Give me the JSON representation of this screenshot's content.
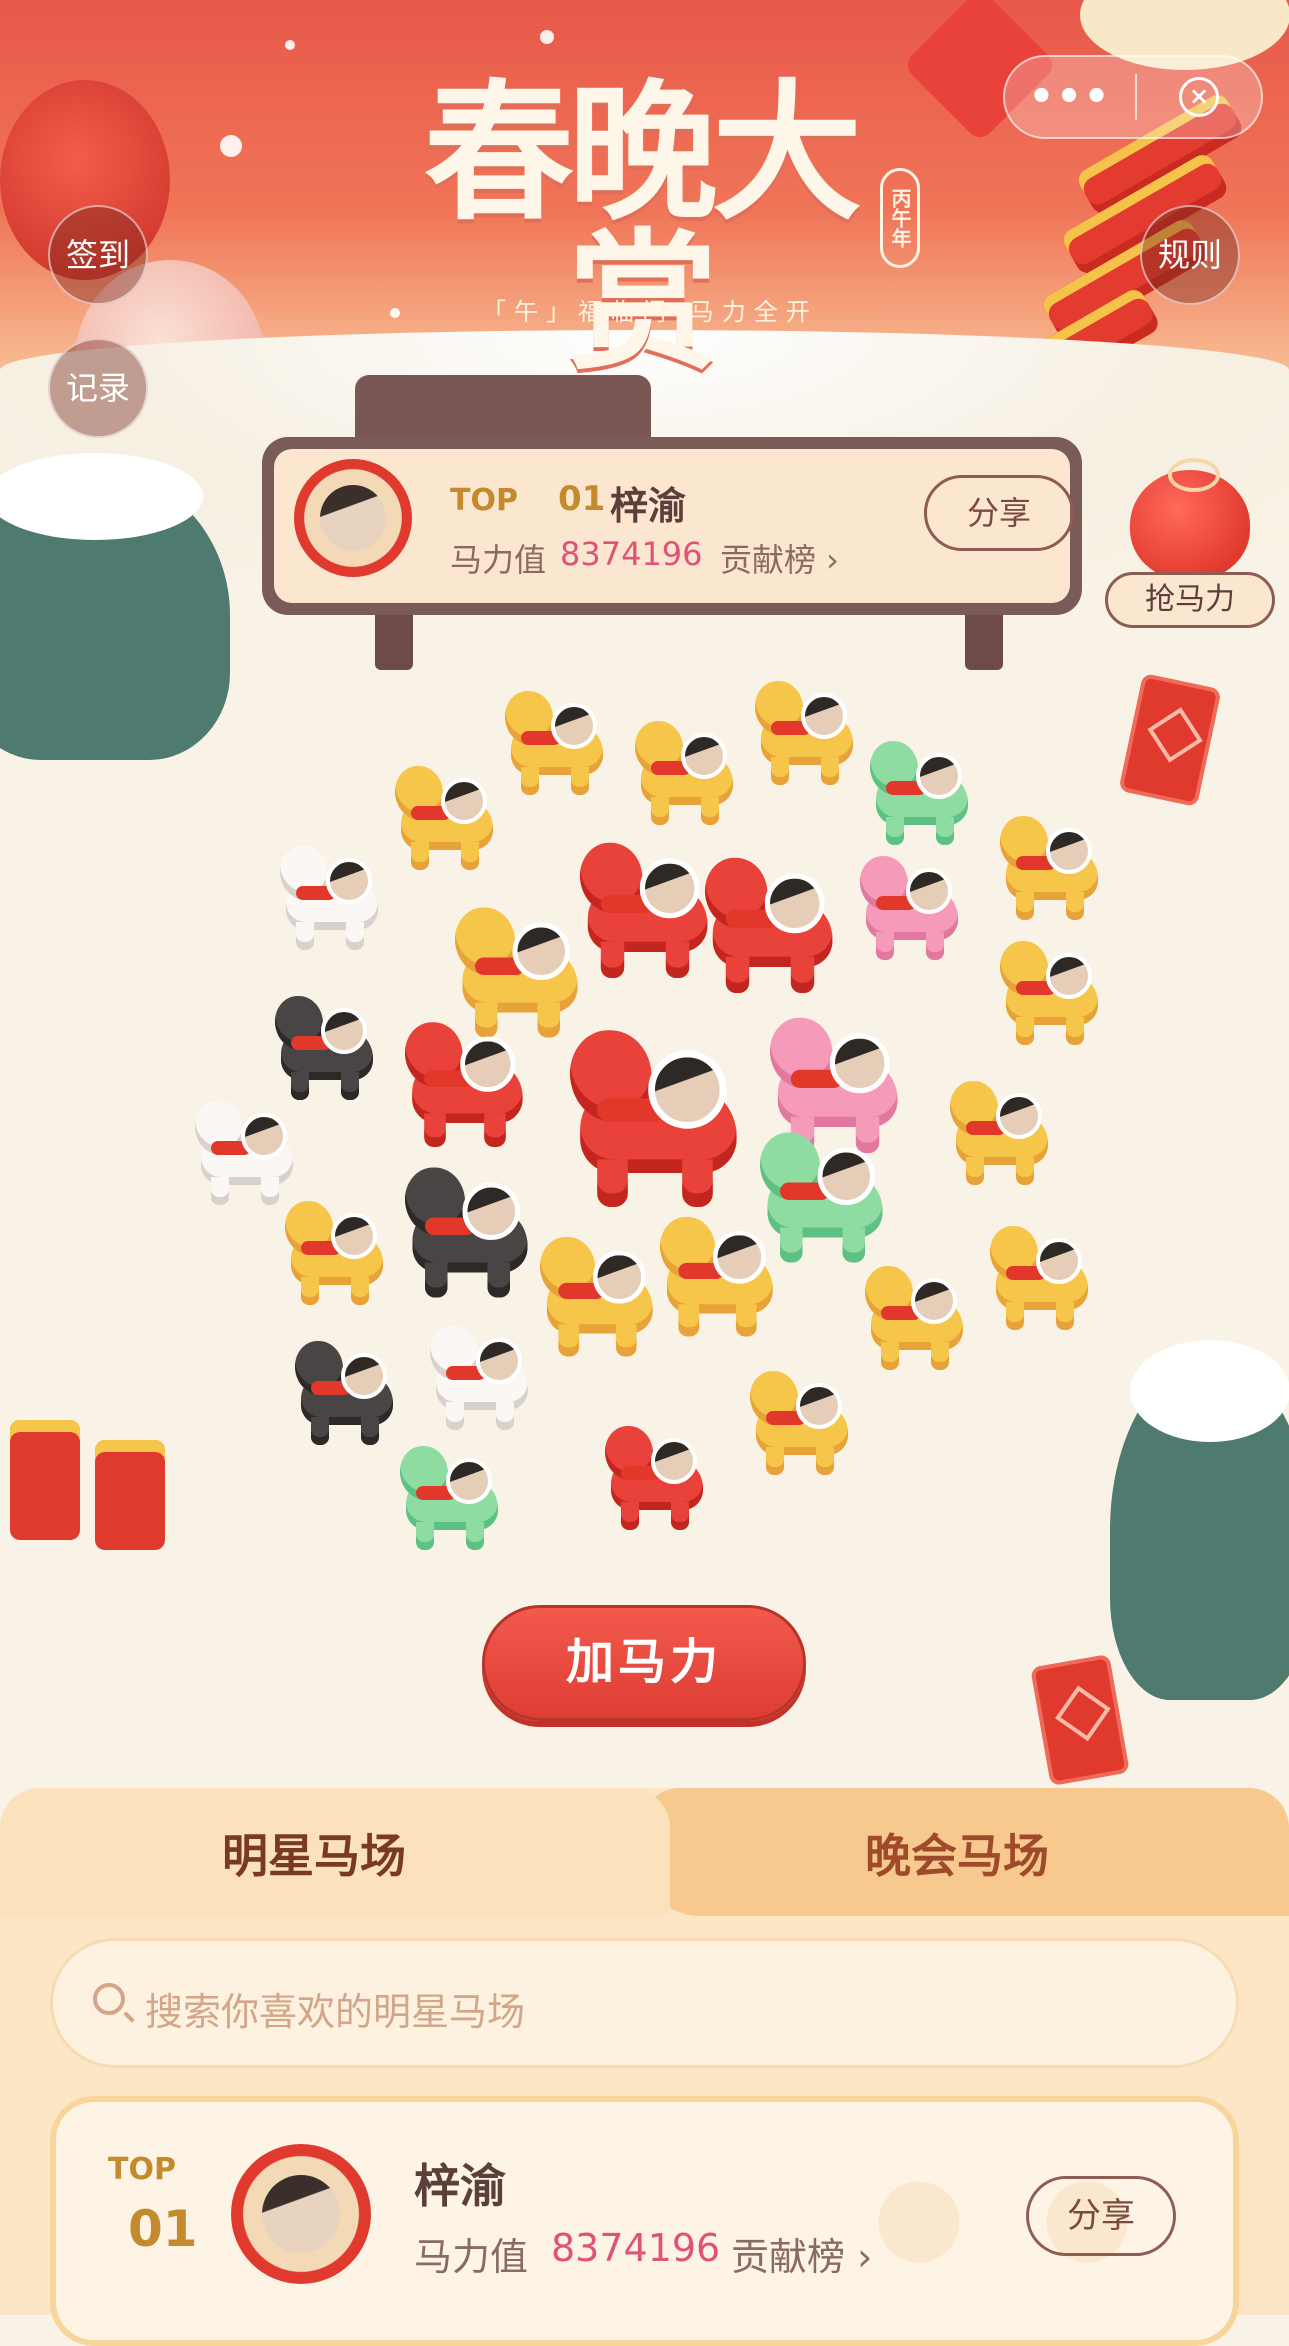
{
  "header": {
    "title": "春晚大赏",
    "year_seal": "丙午年",
    "subtitle": "「午」福临门  马力全开"
  },
  "capsule": {
    "more": "•••",
    "close": "×"
  },
  "side_buttons": {
    "checkin": "签到",
    "records": "记录",
    "rules": "规则"
  },
  "leader": {
    "top_label": "TOP",
    "rank": "01",
    "name": "梓渝",
    "power_label": "马力值",
    "power_value": "8374196",
    "contrib": "贡献榜 ›",
    "share": "分享"
  },
  "grab": {
    "label": "抢马力"
  },
  "horses_count_visual": 33,
  "cta": {
    "label": "加马力"
  },
  "tabs": {
    "active": "明星马场",
    "inactive": "晚会马场"
  },
  "search": {
    "placeholder": "搜索你喜欢的明星马场"
  },
  "list": [
    {
      "top_label": "TOP",
      "rank": "01",
      "name": "梓渝",
      "power_label": "马力值",
      "power_value": "8374196",
      "contrib": "贡献榜 ›",
      "share": "分享"
    }
  ],
  "colors": {
    "accent": "#e8423a",
    "power_value": "#e0527a",
    "gold": "#c48a2e"
  }
}
